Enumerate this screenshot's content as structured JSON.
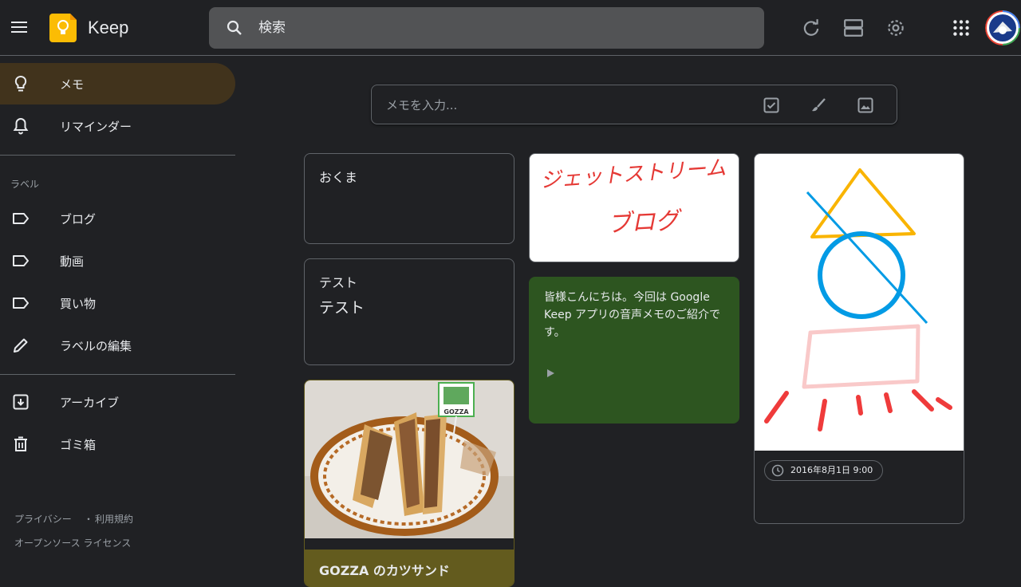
{
  "app": {
    "name": "Keep"
  },
  "header": {
    "search_placeholder": "検索"
  },
  "sidebar": {
    "items": [
      {
        "label": "メモ",
        "icon": "lightbulb-icon",
        "active": true
      },
      {
        "label": "リマインダー",
        "icon": "bell-icon",
        "active": false
      }
    ],
    "labels_heading": "ラベル",
    "labels": [
      {
        "label": "ブログ",
        "icon": "label-icon"
      },
      {
        "label": "動画",
        "icon": "label-icon"
      },
      {
        "label": "買い物",
        "icon": "label-icon"
      },
      {
        "label": "ラベルの編集",
        "icon": "pencil-icon"
      }
    ],
    "bottom_items": [
      {
        "label": "アーカイブ",
        "icon": "archive-icon"
      },
      {
        "label": "ゴミ箱",
        "icon": "trash-icon"
      }
    ],
    "footer": {
      "privacy": "プライバシー",
      "separator": "・",
      "terms": "利用規約",
      "oss": "オープンソース ライセンス"
    }
  },
  "take_note": {
    "placeholder": "メモを入力..."
  },
  "notes": {
    "okuma": {
      "title": "おくま"
    },
    "test": {
      "title": "テスト",
      "body": "テスト"
    },
    "drawing1": {
      "handwriting_line1": "ジェットストリーム",
      "handwriting_line2": "ブログ"
    },
    "voice": {
      "text": "皆様こんにちは。今回は Google Keep アプリの音声メモのご紹介です。",
      "color": "#2d5520"
    },
    "gozza": {
      "caption": "GOZZA のカツサンド",
      "sign_text": "GOZZA",
      "caption_color": "#635b1e"
    },
    "drawing2": {
      "reminder": "2016年8月1日 9:00"
    }
  },
  "colors": {
    "background": "#202124",
    "active_nav": "#41331c",
    "accent": "#fbbc04"
  }
}
